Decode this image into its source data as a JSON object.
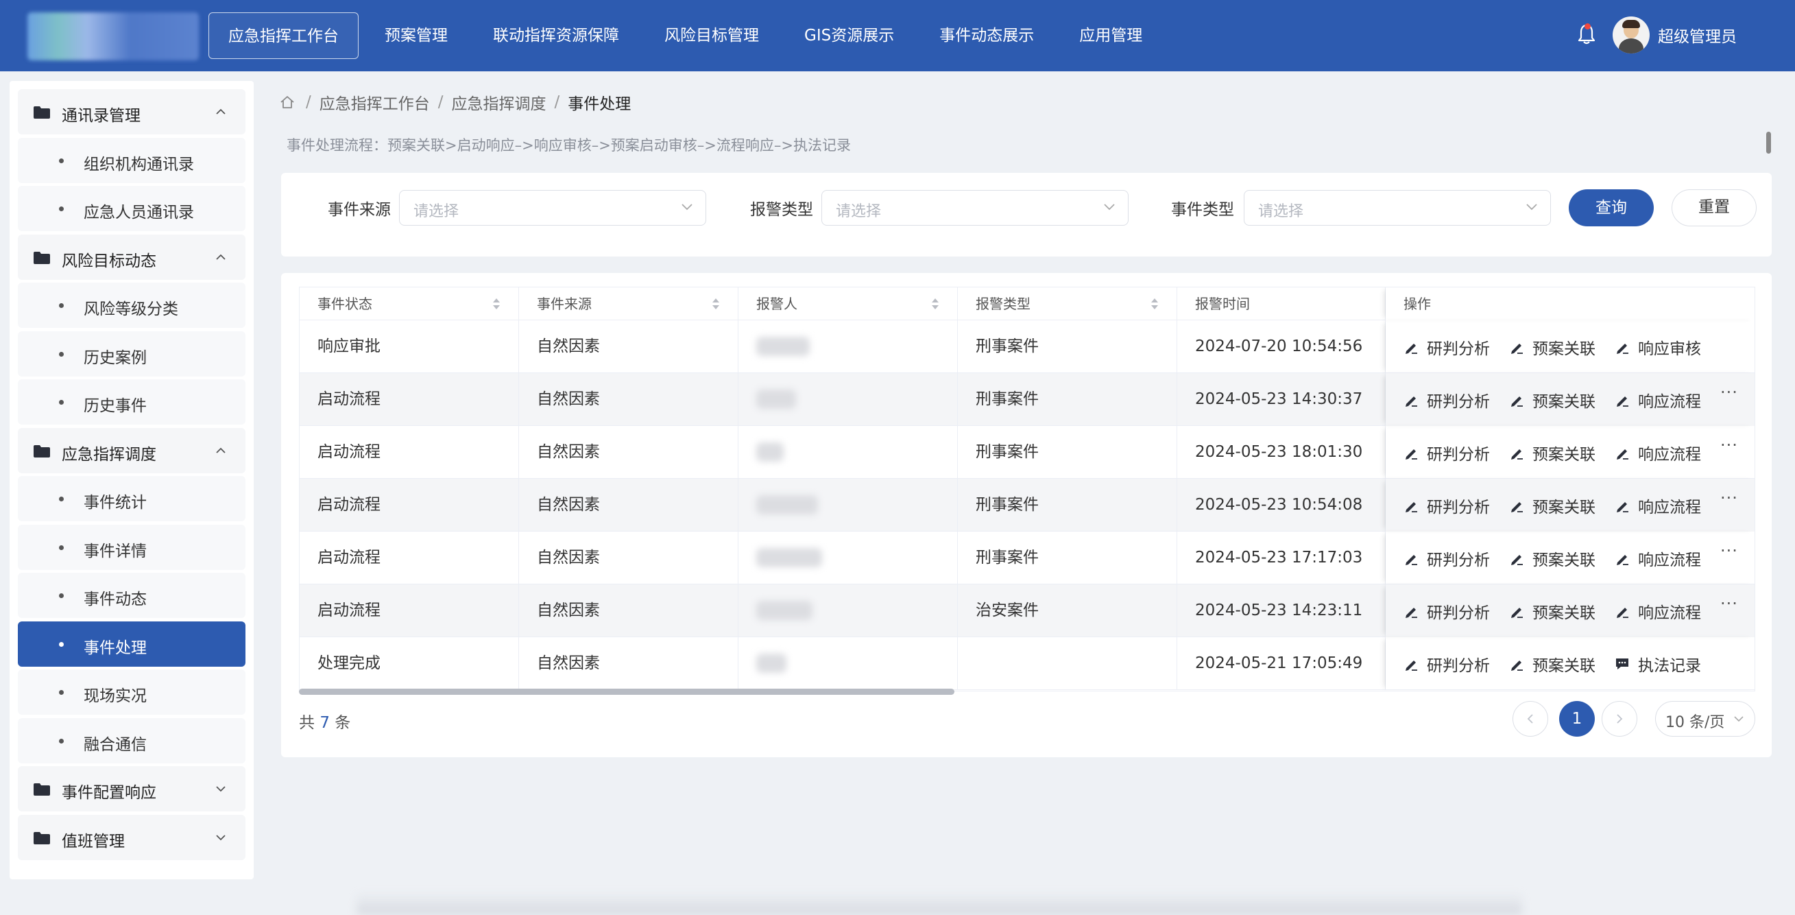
{
  "header": {
    "nav": [
      "应急指挥工作台",
      "预案管理",
      "联动指挥资源保障",
      "风险目标管理",
      "GIS资源展示",
      "事件动态展示",
      "应用管理"
    ],
    "active_nav": "应急指挥工作台",
    "username": "超级管理员",
    "bell_icon": "bell-icon",
    "brand_color": "#2d5bb0"
  },
  "sidebar": {
    "groups": [
      {
        "label": "通讯录管理",
        "items": [
          "组织机构通讯录",
          "应急人员通讯录"
        ]
      },
      {
        "label": "风险目标动态",
        "items": [
          "风险等级分类",
          "历史案例",
          "历史事件"
        ]
      },
      {
        "label": "应急指挥调度",
        "items": [
          "事件统计",
          "事件详情",
          "事件动态",
          "事件处理",
          "现场实况",
          "融合通信"
        ]
      },
      {
        "label": "事件配置响应",
        "items": []
      },
      {
        "label": "值班管理",
        "items": []
      }
    ],
    "active_item": "事件处理"
  },
  "breadcrumb": [
    "应急指挥工作台",
    "应急指挥调度",
    "事件处理"
  ],
  "flow_text": "事件处理流程：预案关联>启动响应–>响应审核–>预案启动审核–>流程响应–>执法记录",
  "filters": [
    {
      "label": "事件来源",
      "placeholder": "请选择"
    },
    {
      "label": "报警类型",
      "placeholder": "请选择"
    },
    {
      "label": "事件类型",
      "placeholder": "请选择"
    }
  ],
  "buttons": {
    "query": "查询",
    "reset": "重置"
  },
  "table": {
    "columns": [
      "事件状态",
      "事件来源",
      "报警人",
      "报警类型",
      "报警时间",
      "操作"
    ],
    "rows": [
      {
        "status": "响应审批",
        "source": "自然因素",
        "type": "刑事案件",
        "time": "2024-07-20 10:54:56",
        "ops": [
          "研判分析",
          "预案关联",
          "响应审核"
        ],
        "more": false
      },
      {
        "status": "启动流程",
        "source": "自然因素",
        "type": "刑事案件",
        "time": "2024-05-23 14:30:37",
        "ops": [
          "研判分析",
          "预案关联",
          "响应流程"
        ],
        "more": true
      },
      {
        "status": "启动流程",
        "source": "自然因素",
        "type": "刑事案件",
        "time": "2024-05-23 18:01:30",
        "ops": [
          "研判分析",
          "预案关联",
          "响应流程"
        ],
        "more": true
      },
      {
        "status": "启动流程",
        "source": "自然因素",
        "type": "刑事案件",
        "time": "2024-05-23 10:54:08",
        "ops": [
          "研判分析",
          "预案关联",
          "响应流程"
        ],
        "more": true
      },
      {
        "status": "启动流程",
        "source": "自然因素",
        "type": "刑事案件",
        "time": "2024-05-23 17:17:03",
        "ops": [
          "研判分析",
          "预案关联",
          "响应流程"
        ],
        "more": true
      },
      {
        "status": "启动流程",
        "source": "自然因素",
        "type": "治安案件",
        "time": "2024-05-23 14:23:11",
        "ops": [
          "研判分析",
          "预案关联",
          "响应流程"
        ],
        "more": true
      },
      {
        "status": "处理完成",
        "source": "自然因素",
        "type": "",
        "time": "2024-05-21 17:05:49",
        "ops": [
          "研判分析",
          "预案关联",
          "执法记录"
        ],
        "more": false
      }
    ]
  },
  "pagination": {
    "total_prefix": "共",
    "total": "7",
    "total_suffix": "条",
    "current_page": "1",
    "page_size": "10 条/页"
  }
}
